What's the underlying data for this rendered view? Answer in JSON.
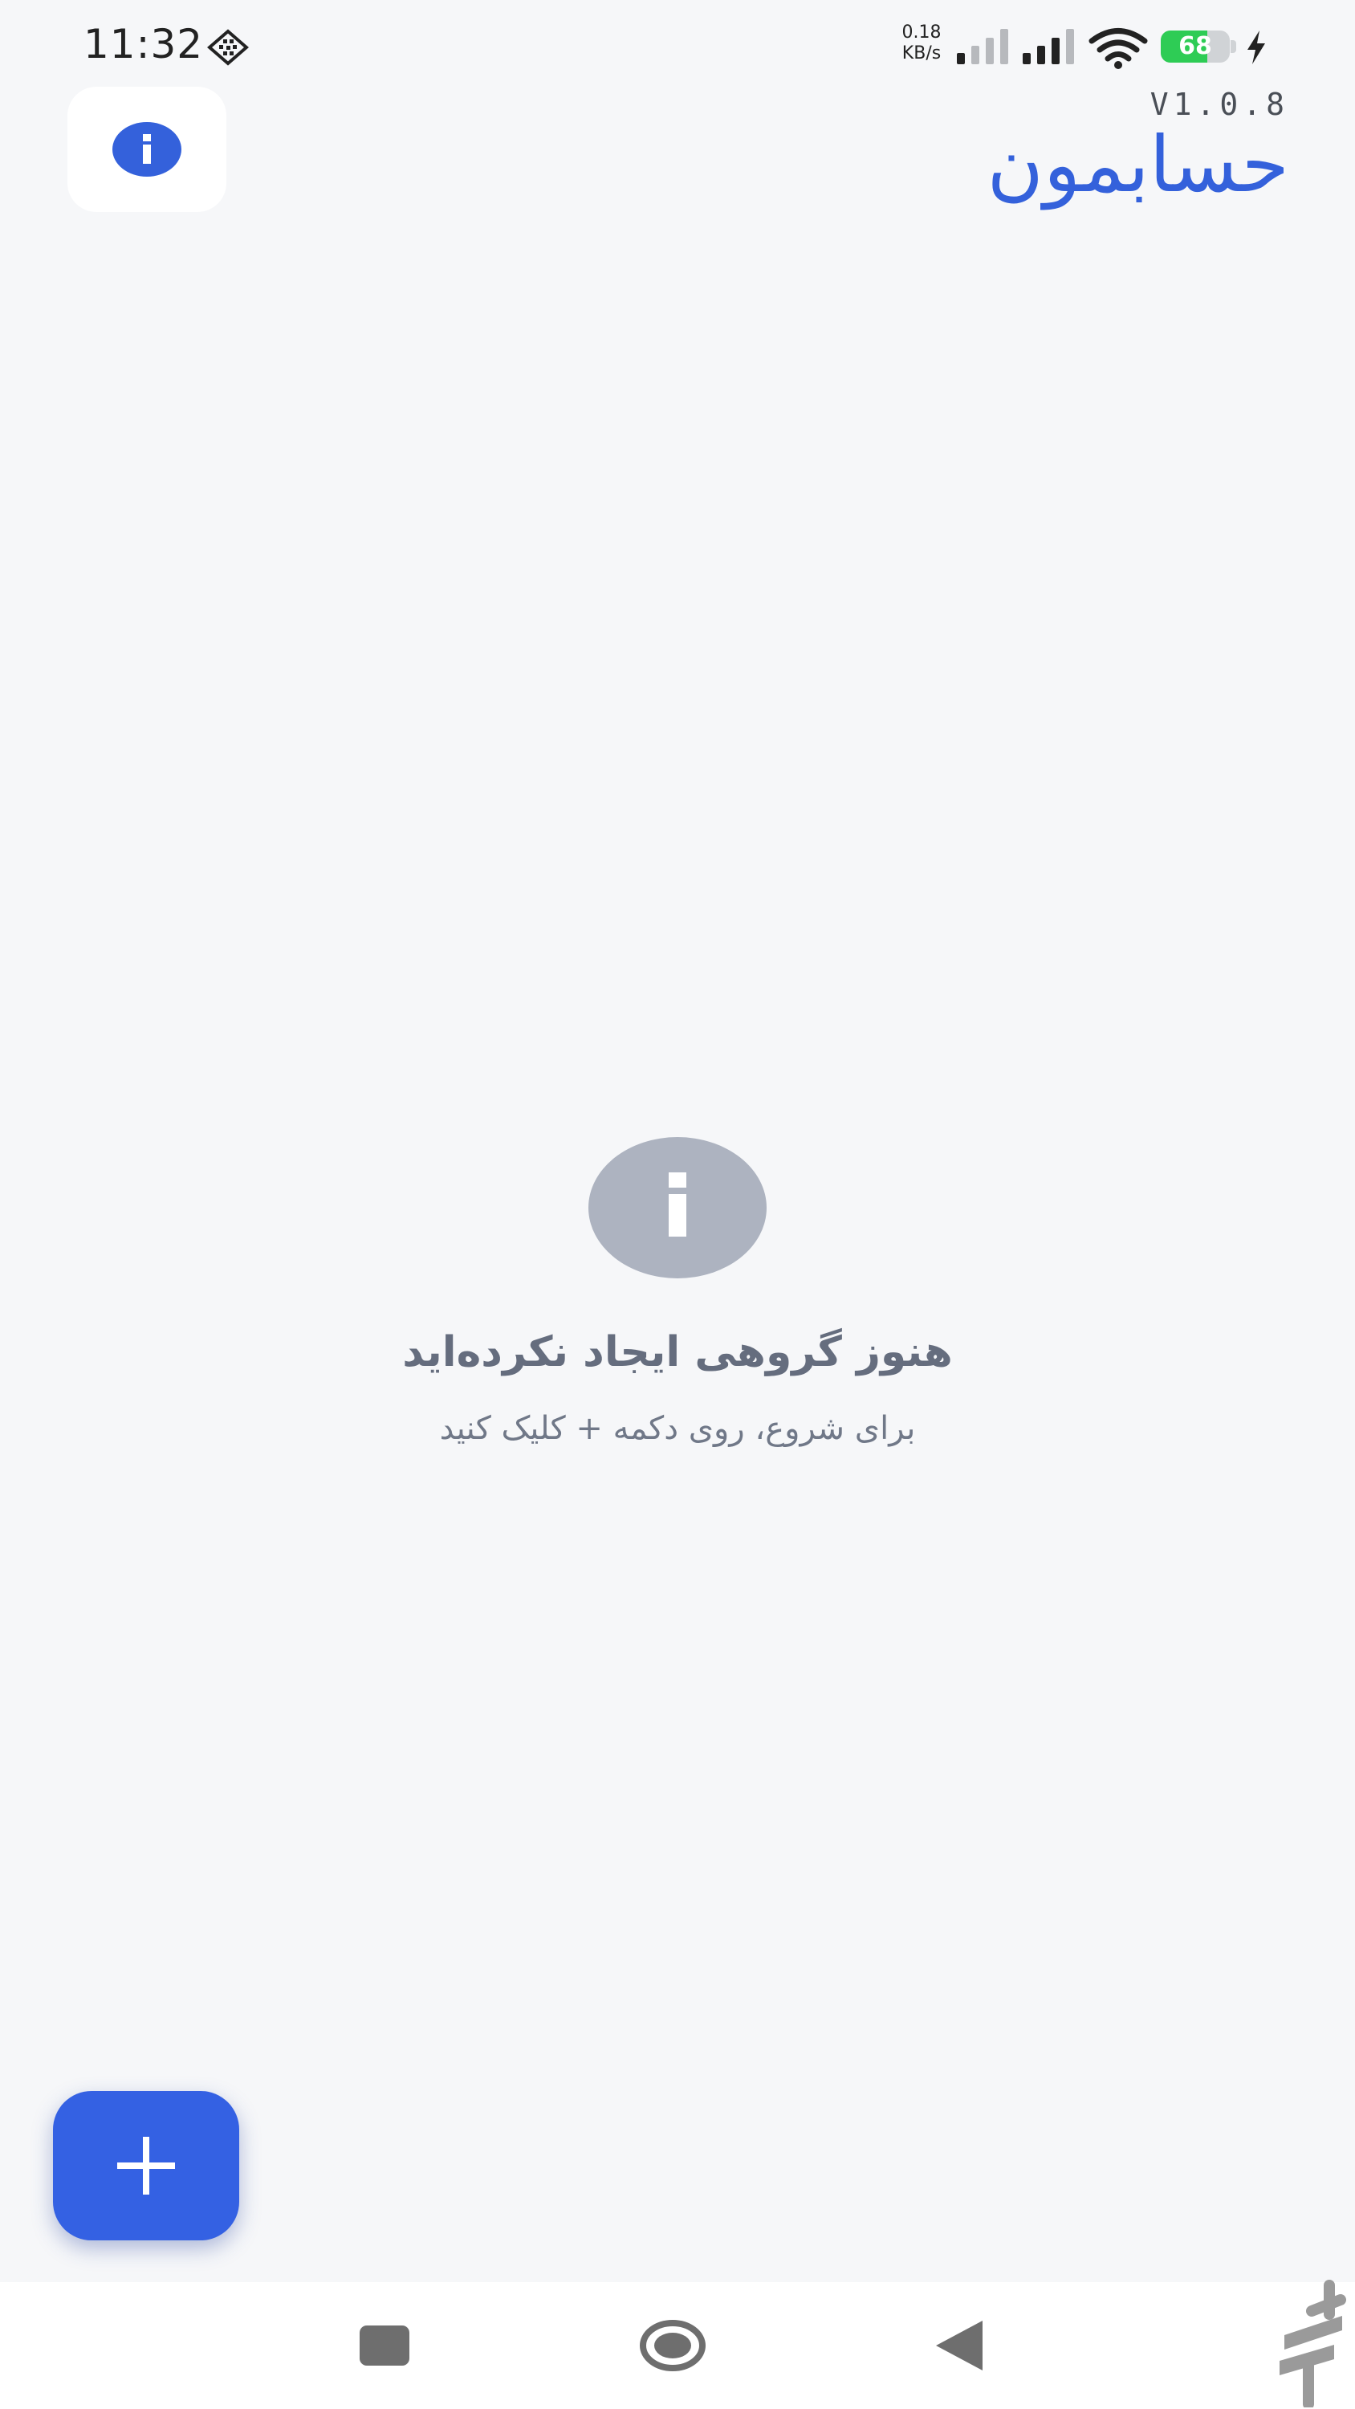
{
  "status_bar": {
    "time": "11:32",
    "net_speed_value": "0.18",
    "net_speed_unit": "KB/s",
    "battery_level": "68",
    "battery_fraction": 0.68,
    "icons": [
      "notification-icon",
      "signal-icon",
      "signal-icon",
      "wifi-icon",
      "battery-icon",
      "charging-icon"
    ]
  },
  "header": {
    "version": "V1.0.8",
    "title": "حسابمون",
    "info_button_icon": "info-icon"
  },
  "empty_state": {
    "icon": "info-icon",
    "title": "هنوز گروهی ایجاد نکرده‌اید",
    "subtitle": "برای شروع، روی دکمه + کلیک کنید"
  },
  "fab": {
    "icon": "plus-icon"
  },
  "nav_bar": {
    "icons": [
      "recents-icon",
      "home-icon",
      "back-icon"
    ]
  },
  "colors": {
    "background": "#f6f7f9",
    "accent": "#3461db",
    "fab": "#3461e3",
    "empty_icon": "#adb3c0",
    "empty_text": "#656d7e",
    "battery_fill": "#2ecc55"
  }
}
